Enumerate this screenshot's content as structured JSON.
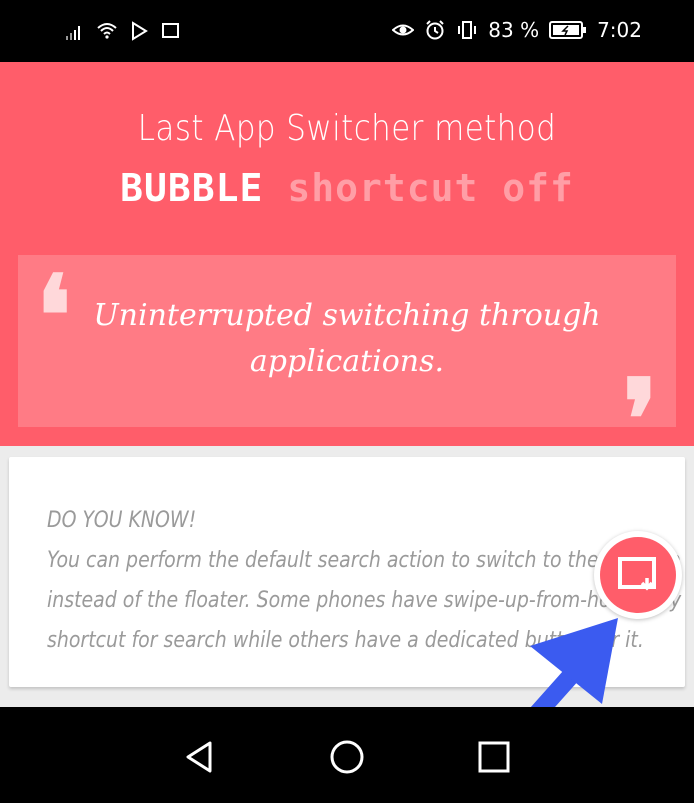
{
  "status_bar": {
    "battery_percent": "83 %",
    "time": "7:02",
    "left_icons": [
      "signal-icon",
      "wifi-icon",
      "play-icon",
      "screencast-icon"
    ],
    "right_icons": [
      "eye-icon",
      "alarm-icon",
      "vibrate-icon",
      "battery-icon"
    ]
  },
  "header": {
    "title": "Last App Switcher method",
    "subtitle_strong": "BUBBLE",
    "subtitle_dim": "shortcut off",
    "quote": "Uninterrupted switching through applications.",
    "background": "#ff5d6a"
  },
  "tip_card": {
    "lines": [
      "DO YOU KNOW!",
      "You can perform the default search action to switch to the last app",
      "instead of the floater. Some phones have swipe-up-from-home-key",
      "shortcut for search while others have a dedicated button for it."
    ]
  },
  "bubble": {
    "icon": "last-app-icon",
    "color": "#ff5d6a"
  },
  "annotation": {
    "icon": "arrow-icon",
    "color": "#3b5bf0"
  },
  "nav_bar": {
    "buttons": [
      "back-icon",
      "home-icon",
      "recents-icon"
    ]
  }
}
